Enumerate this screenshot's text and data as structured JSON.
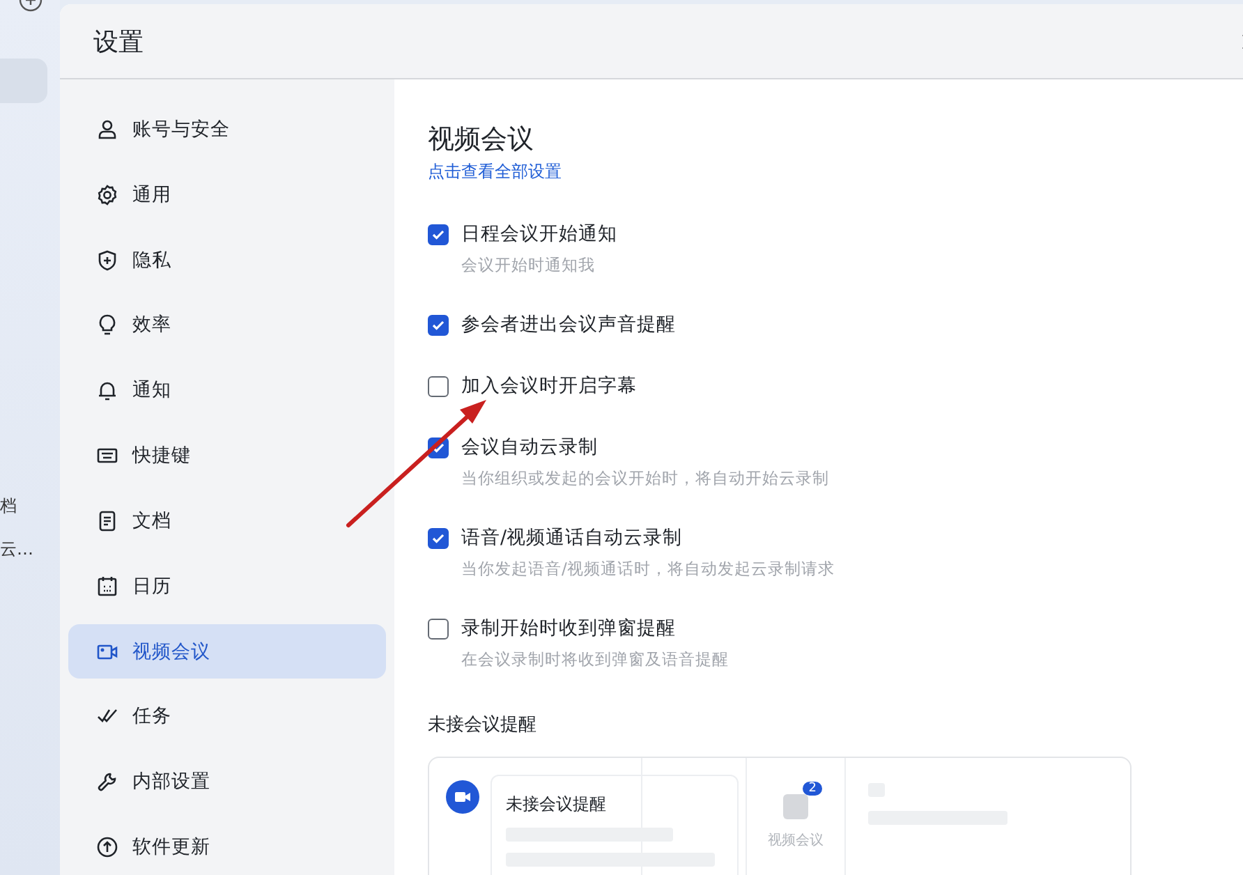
{
  "background_app": {
    "items": [
      {
        "label": "档"
      },
      {
        "label": "云…"
      }
    ]
  },
  "window": {
    "title": "设置"
  },
  "sidebar": {
    "items": [
      {
        "label": "账号与安全",
        "selected": false
      },
      {
        "label": "通用",
        "selected": false
      },
      {
        "label": "隐私",
        "selected": false
      },
      {
        "label": "效率",
        "selected": false
      },
      {
        "label": "通知",
        "selected": false
      },
      {
        "label": "快捷键",
        "selected": false
      },
      {
        "label": "文档",
        "selected": false
      },
      {
        "label": "日历",
        "selected": false
      },
      {
        "label": "视频会议",
        "selected": true
      },
      {
        "label": "任务",
        "selected": false
      },
      {
        "label": "内部设置",
        "selected": false
      },
      {
        "label": "软件更新",
        "selected": false
      }
    ]
  },
  "content": {
    "title": "视频会议",
    "link": "点击查看全部设置",
    "options": [
      {
        "label": "日程会议开始通知",
        "description": "会议开始时通知我",
        "checked": true
      },
      {
        "label": "参会者进出会议声音提醒",
        "checked": true
      },
      {
        "label": "加入会议时开启字幕",
        "checked": false
      },
      {
        "label": "会议自动云录制",
        "description": "当你组织或发起的会议开始时，将自动开始云录制",
        "checked": true
      },
      {
        "label": "语音/视频通话自动云录制",
        "description": "当你发起语音/视频通话时，将自动发起云录制请求",
        "checked": true
      },
      {
        "label": "录制开始时收到弹窗提醒",
        "description": "在会议录制时将收到弹窗及语音提醒",
        "checked": false
      }
    ],
    "missed_section": {
      "title": "未接会议提醒",
      "preview_title": "未接会议提醒",
      "badge": "2",
      "app_label": "视频会议"
    }
  }
}
